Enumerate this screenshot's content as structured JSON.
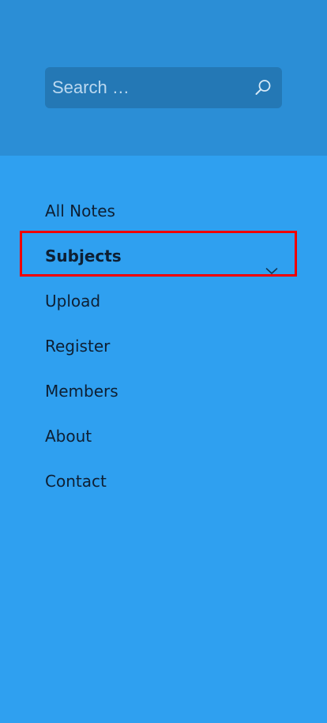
{
  "search": {
    "placeholder": "Search …"
  },
  "icons": {
    "search": "search-icon",
    "submenu": "chevron-down-icon"
  },
  "colors": {
    "header_bg": "#2b8ed6",
    "menu_bg": "#2fa0f0",
    "search_bg": "#2478b5",
    "highlight": "#f00000"
  },
  "nav": {
    "items": [
      {
        "label": "All Notes"
      },
      {
        "label": "Subjects",
        "has_submenu": true
      },
      {
        "label": "Upload"
      },
      {
        "label": "Register"
      },
      {
        "label": "Members"
      },
      {
        "label": "About"
      },
      {
        "label": "Contact"
      }
    ]
  }
}
